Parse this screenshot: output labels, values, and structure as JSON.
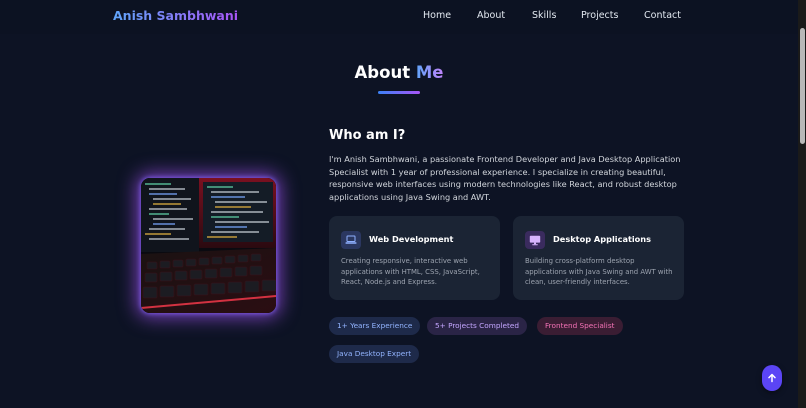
{
  "navbar": {
    "logo": "Anish Sambhwani",
    "links": [
      "Home",
      "About",
      "Skills",
      "Projects",
      "Contact"
    ]
  },
  "about": {
    "title_main": "About",
    "title_accent": "Me",
    "heading": "Who am I?",
    "bio": "I'm Anish Sambhwani, a passionate Frontend Developer and Java Desktop Application Specialist with 1 year of professional experience. I specialize in creating beautiful, responsive web interfaces using modern technologies like React, and robust desktop applications using Java Swing and AWT.",
    "cards": [
      {
        "icon": "laptop-icon",
        "title": "Web Development",
        "description": "Creating responsive, interactive web applications with HTML, CSS, JavaScript, React, Node.js and Express."
      },
      {
        "icon": "monitor-icon",
        "title": "Desktop Applications",
        "description": "Building cross-platform desktop applications with Java Swing and AWT with clean, user-friendly interfaces."
      }
    ],
    "pills": [
      {
        "label": "1+ Years Experience",
        "color": "#93b4ff",
        "bg": "#1e2a4a"
      },
      {
        "label": "5+ Projects Completed",
        "color": "#c4a6ff",
        "bg": "#2a2446"
      },
      {
        "label": "Frontend Specialist",
        "color": "#f472b6",
        "bg": "#3a1d33"
      },
      {
        "label": "Java Desktop Expert",
        "color": "#93b4ff",
        "bg": "#1e2a4a"
      }
    ]
  },
  "colors": {
    "background": "#0d1324",
    "accent_blue": "#60a5fa",
    "accent_purple": "#a855f7",
    "card_bg": "#1b2434",
    "scroll_button": "#5b45f5"
  },
  "scroll_top": {
    "icon": "arrow-up-icon"
  }
}
